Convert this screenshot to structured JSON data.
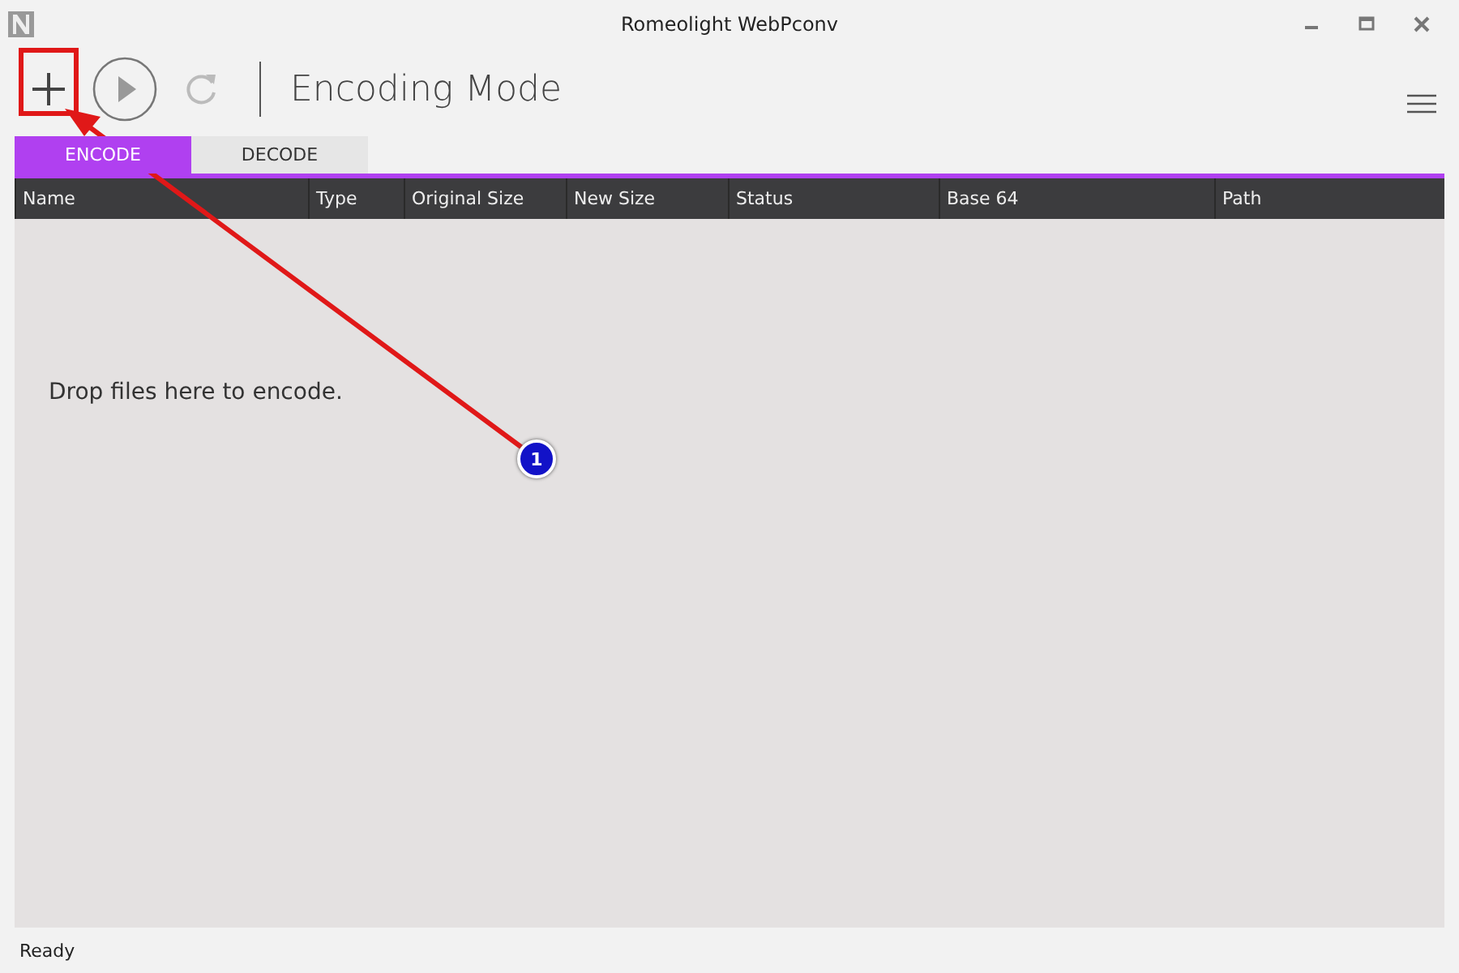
{
  "window": {
    "title": "Romeolight WebPconv"
  },
  "toolbar": {
    "heading": "Encoding Mode"
  },
  "tabs": [
    {
      "label": "ENCODE",
      "selected": true
    },
    {
      "label": "DECODE",
      "selected": false
    }
  ],
  "table": {
    "columns": [
      "Name",
      "Type",
      "Original Size",
      "New Size",
      "Status",
      "Base 64",
      "Path"
    ],
    "empty_message": "Drop files here to encode."
  },
  "status_bar": "Ready",
  "annotation": {
    "callout": "1"
  }
}
